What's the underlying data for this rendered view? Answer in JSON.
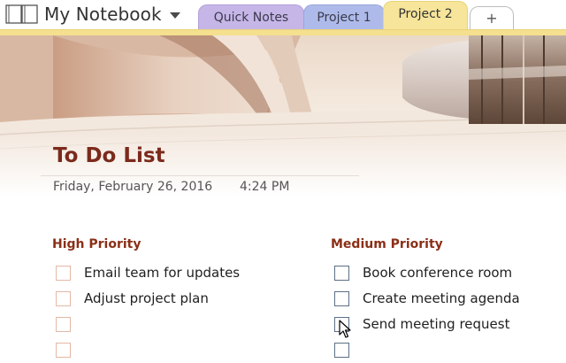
{
  "header": {
    "notebook_title": "My Notebook",
    "tabs": [
      {
        "label": "Quick Notes",
        "active": false
      },
      {
        "label": "Project 1",
        "active": false
      },
      {
        "label": "Project 2",
        "active": true
      }
    ],
    "add_tab_label": "+"
  },
  "page": {
    "title": "To Do List",
    "date": "Friday, February 26, 2016",
    "time": "4:24 PM"
  },
  "columns": [
    {
      "title": "High Priority",
      "items": [
        {
          "text": "Email team for updates",
          "checked": false
        },
        {
          "text": "Adjust project plan",
          "checked": false
        },
        {
          "text": "",
          "checked": false
        },
        {
          "text": "",
          "checked": false
        }
      ]
    },
    {
      "title": "Medium Priority",
      "items": [
        {
          "text": "Book conference room",
          "checked": false
        },
        {
          "text": "Create meeting agenda",
          "checked": false
        },
        {
          "text": "Send meeting request",
          "checked": false
        },
        {
          "text": "",
          "checked": false
        }
      ]
    }
  ],
  "colors": {
    "tab_quick_notes": "#c6b6e8",
    "tab_project_1": "#aebbea",
    "tab_project_2": "#f6e59a",
    "title_color": "#7b2a1c",
    "heading_color": "#8a2f17",
    "left_checkbox_border": "#e4b8a6",
    "right_checkbox_border": "#5c6f86"
  },
  "icons": {
    "notebook": "notebook-icon",
    "dropdown": "chevron-down-icon",
    "cursor": "mouse-pointer-icon"
  }
}
